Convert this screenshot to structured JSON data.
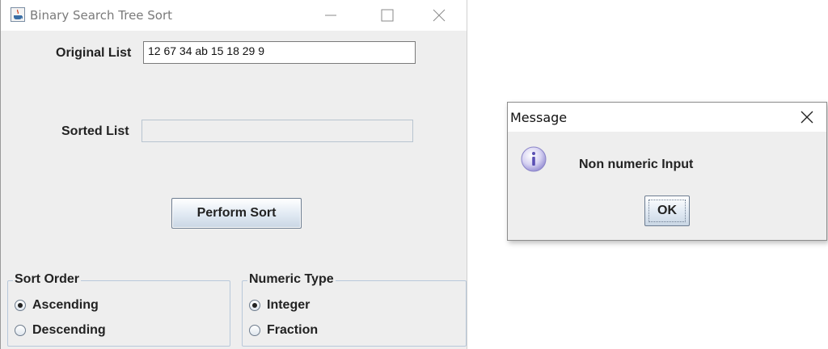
{
  "main_window": {
    "title": "Binary Search Tree Sort",
    "original_list_label": "Original List",
    "original_list_value": "12 67 34 ab 15 18 29 9",
    "sorted_list_label": "Sorted List",
    "sorted_list_value": "",
    "perform_button_label": "Perform Sort",
    "sort_order": {
      "title": "Sort Order",
      "options": [
        "Ascending",
        "Descending"
      ],
      "selected": "Ascending"
    },
    "numeric_type": {
      "title": "Numeric Type",
      "options": [
        "Integer",
        "Fraction"
      ],
      "selected": "Integer"
    }
  },
  "dialog": {
    "title": "Message",
    "message": "Non numeric Input",
    "ok_label": "OK",
    "icon": "info-icon"
  },
  "colors": {
    "window_bg": "#eeeeee",
    "button_border": "#6c7c90",
    "group_border": "#b8c8da"
  }
}
